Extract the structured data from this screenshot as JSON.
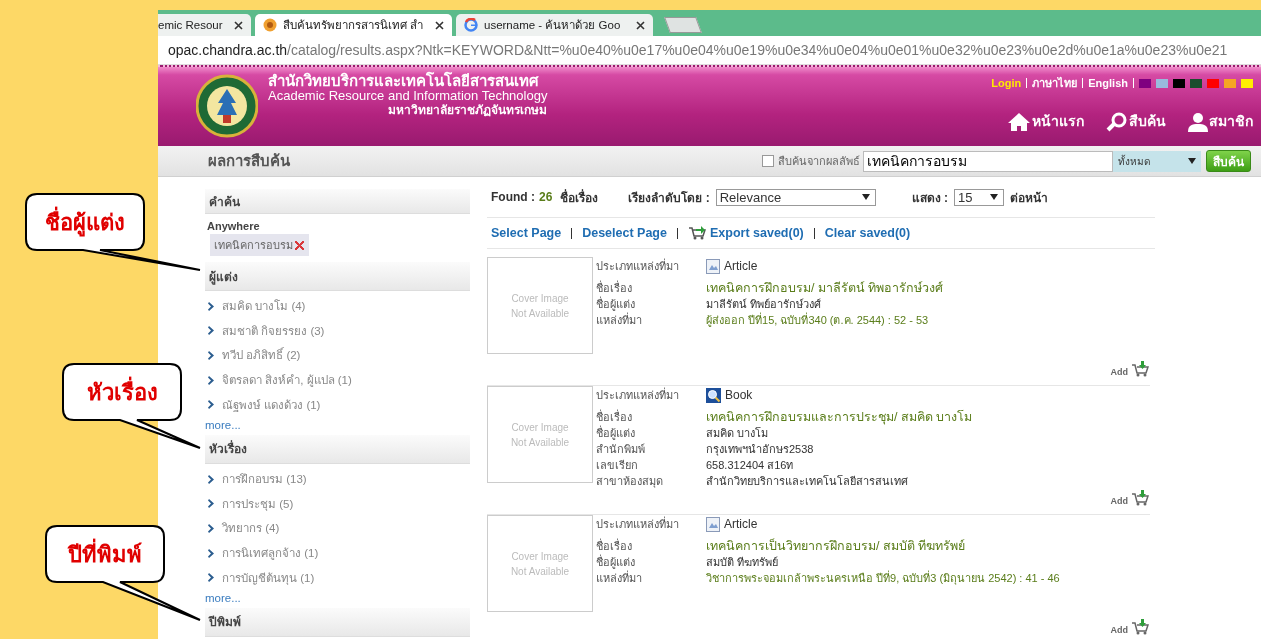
{
  "browser": {
    "tabs": [
      {
        "label": "emic Resour",
        "selected": false,
        "kind": "plain"
      },
      {
        "label": "สืบค้นทรัพยากรสารนิเทศ สำ",
        "selected": true,
        "kind": "site"
      },
      {
        "label": "username - ค้นหาด้วย Goo",
        "selected": false,
        "kind": "google"
      }
    ],
    "address": {
      "host": "opac.chandra.ac.th",
      "path": "/catalog/results.aspx?Ntk=KEYWORD&Ntt=%u0e40%u0e17%u0e04%u0e19%u0e34%u0e04%u0e01%u0e32%u0e23%u0e2d%u0e1a%u0e23%u0e21"
    }
  },
  "site_header": {
    "title_th": "สำนักวิทยบริการและเทคโนโลยีสารสนเทศ",
    "title_en": "Academic Resource and Information Technology",
    "university": "มหาวิทยาลัยราชภัฏจันทรเกษม",
    "top_links": [
      {
        "label": "Login",
        "kind": "login"
      },
      {
        "label": "ภาษาไทย",
        "kind": "plain"
      },
      {
        "label": "English",
        "kind": "plain"
      }
    ],
    "theme_colors": [
      {
        "color": "#800080"
      },
      {
        "color": "#99bbdd"
      },
      {
        "color": "#000000"
      },
      {
        "color": "#1a4d2e"
      },
      {
        "color": "#ff0000"
      },
      {
        "color": "#f5a623"
      },
      {
        "color": "#ffee00"
      }
    ],
    "nav": [
      {
        "label": "หน้าแรก",
        "kind": "home"
      },
      {
        "label": "สืบค้น",
        "kind": "search"
      },
      {
        "label": "สมาชิก",
        "kind": "member"
      }
    ]
  },
  "search_strip": {
    "heading": "ผลการสืบค้น",
    "within_results": {
      "label": "สืบค้นจากผลลัพธ์",
      "checked": false
    },
    "query": "เทคนิคการอบรม",
    "scope": "ทั้งหมด",
    "button": "สืบค้น"
  },
  "sidebar": {
    "search_terms": {
      "title": "คำค้น",
      "field": "Anywhere",
      "term": "เทคนิคการอบรม"
    },
    "facets": [
      {
        "title": "ผู้แต่ง",
        "items": [
          "สมคิด บางโม (4)",
          "สมชาติ กิจยรรยง (3)",
          "ทวีป อภิสิทธิ์ (2)",
          "จิตรลดา สิงห์คำ, ผู้แปล (1)",
          "ณัฐพงษ์ แดงด้วง (1)"
        ],
        "more": "more..."
      },
      {
        "title": "หัวเรื่อง",
        "items": [
          "การฝึกอบรม (13)",
          "การประชุม (5)",
          "วิทยากร (4)",
          "การนิเทศลูกจ้าง (1)",
          "การบัญชีต้นทุน (1)"
        ],
        "more": "more..."
      },
      {
        "title": "ปีพิมพ์"
      }
    ]
  },
  "results_toolbar": {
    "found_label": "Found :",
    "count": "26",
    "count_unit": "ชื่อเรื่อง",
    "sort_label": "เรียงลำดับโดย :",
    "sort_value": "Relevance",
    "show_label": "แสดง :",
    "per_page": "15",
    "per_page_unit": "ต่อหน้า",
    "actions": [
      {
        "label": "Select Page",
        "kind": "plain"
      },
      {
        "label": "Deselect Page",
        "kind": "plain"
      },
      {
        "label": "Export saved(0)",
        "kind": "export"
      },
      {
        "label": "Clear saved(0)",
        "kind": "plain"
      }
    ]
  },
  "results": [
    {
      "kind": "article",
      "cover": [
        "Cover Image",
        "Not Available"
      ],
      "fields": [
        {
          "label": "ประเภทแหล่งที่มา",
          "value": "Article",
          "kind": "type"
        },
        {
          "label": "ชื่อเรื่อง",
          "value": "เทคนิคการฝึกอบรม/ มาลีรัตน์ ทิพอารักษ์วงศ์",
          "kind": "title"
        },
        {
          "label": "ชื่อผู้แต่ง",
          "value": "มาลีรัตน์ ทิพย์อารักษ์วงศ์",
          "kind": "plain"
        },
        {
          "label": "แหล่งที่มา",
          "value": "ผู้ส่งออก ปีที่15, ฉบับที่340 (ต.ค. 2544) : 52 - 53",
          "kind": "source"
        }
      ],
      "add": "Add"
    },
    {
      "kind": "book",
      "cover": [
        "Cover Image",
        "Not Available"
      ],
      "fields": [
        {
          "label": "ประเภทแหล่งที่มา",
          "value": "Book",
          "kind": "type"
        },
        {
          "label": "ชื่อเรื่อง",
          "value": "เทคนิคการฝึกอบรมและการประชุม/ สมคิด บางโม",
          "kind": "title"
        },
        {
          "label": "ชื่อผู้แต่ง",
          "value": "สมคิด บางโม",
          "kind": "plain"
        },
        {
          "label": "สำนักพิมพ์",
          "value": "กรุงเทพฯนำอักษร2538",
          "kind": "plain"
        },
        {
          "label": "เลขเรียก",
          "value": "658.312404 ส16ท",
          "kind": "plain"
        },
        {
          "label": "สาขาห้องสมุด",
          "value": "สำนักวิทยบริการและเทคโนโลยีสารสนเทศ",
          "kind": "plain"
        }
      ],
      "add": "Add"
    },
    {
      "kind": "article",
      "cover": [
        "Cover Image",
        "Not Available"
      ],
      "fields": [
        {
          "label": "ประเภทแหล่งที่มา",
          "value": "Article",
          "kind": "type"
        },
        {
          "label": "ชื่อเรื่อง",
          "value": "เทคนิคการเป็นวิทยากรฝึกอบรม/ สมบัติ ทีฆทรัพย์",
          "kind": "title"
        },
        {
          "label": "ชื่อผู้แต่ง",
          "value": "สมบัติ ทีฆทรัพย์",
          "kind": "plain"
        },
        {
          "label": "แหล่งที่มา",
          "value": "วิชาการพระจอมเกล้าพระนครเหนือ ปีที่9, ฉบับที่3 (มิถุนายน 2542) : 41 - 46",
          "kind": "source"
        }
      ],
      "add": "Add"
    }
  ],
  "callouts": [
    {
      "text": "ชื่อผู้แต่ง"
    },
    {
      "text": "หัวเรื่อง"
    },
    {
      "text": "ปีที่พิมพ์"
    }
  ]
}
